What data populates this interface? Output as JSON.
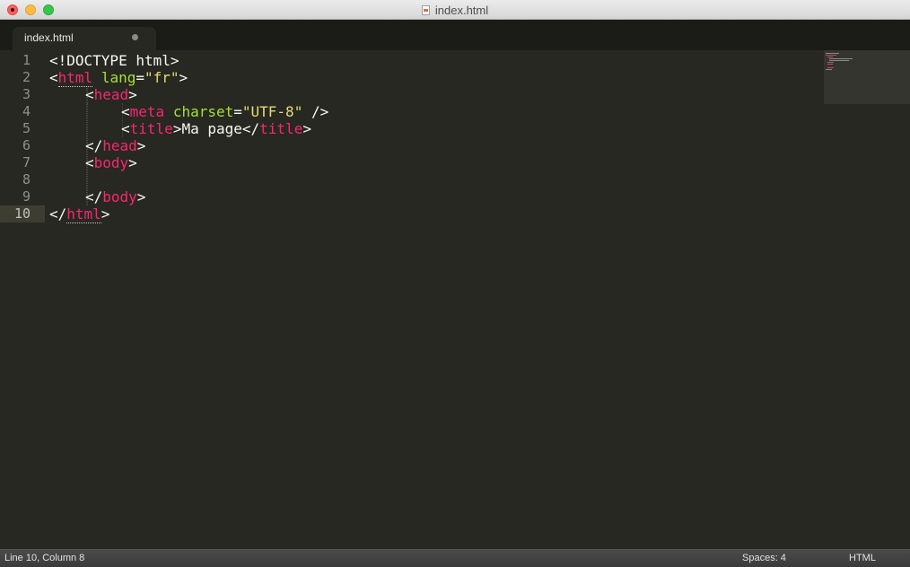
{
  "window": {
    "title": "index.html"
  },
  "tabs": [
    {
      "label": "index.html"
    }
  ],
  "editor": {
    "line_numbers": [
      "1",
      "2",
      "3",
      "4",
      "5",
      "6",
      "7",
      "8",
      "9",
      "10"
    ],
    "active_line": "10",
    "code": {
      "l1": {
        "text": "<!DOCTYPE html>"
      },
      "l2": {
        "lt": "<",
        "tag": "html",
        "sp": " ",
        "attr": "lang",
        "eq": "=",
        "val": "\"fr\"",
        "gt": ">"
      },
      "l3": {
        "lt": "<",
        "tag": "head",
        "gt": ">"
      },
      "l4": {
        "lt": "<",
        "tag": "meta",
        "sp": " ",
        "attr": "charset",
        "eq": "=",
        "val": "\"UTF-8\"",
        "end": " />"
      },
      "l5": {
        "lt": "<",
        "tag": "title",
        "gt": ">",
        "text": "Ma page",
        "clt": "</",
        "ctag": "title",
        "cgt": ">"
      },
      "l6": {
        "lt": "</",
        "tag": "head",
        "gt": ">"
      },
      "l7": {
        "lt": "<",
        "tag": "body",
        "gt": ">"
      },
      "l9": {
        "lt": "</",
        "tag": "body",
        "gt": ">"
      },
      "l10": {
        "lt": "</",
        "tag": "html",
        "gt": ">"
      }
    }
  },
  "statusbar": {
    "position": "Line 10, Column 8",
    "spaces": "Spaces: 4",
    "syntax": "HTML"
  },
  "colors": {
    "background": "#272822",
    "tag": "#f92672",
    "attribute": "#a6e22e",
    "string": "#e6db74",
    "text": "#f8f8f2"
  }
}
